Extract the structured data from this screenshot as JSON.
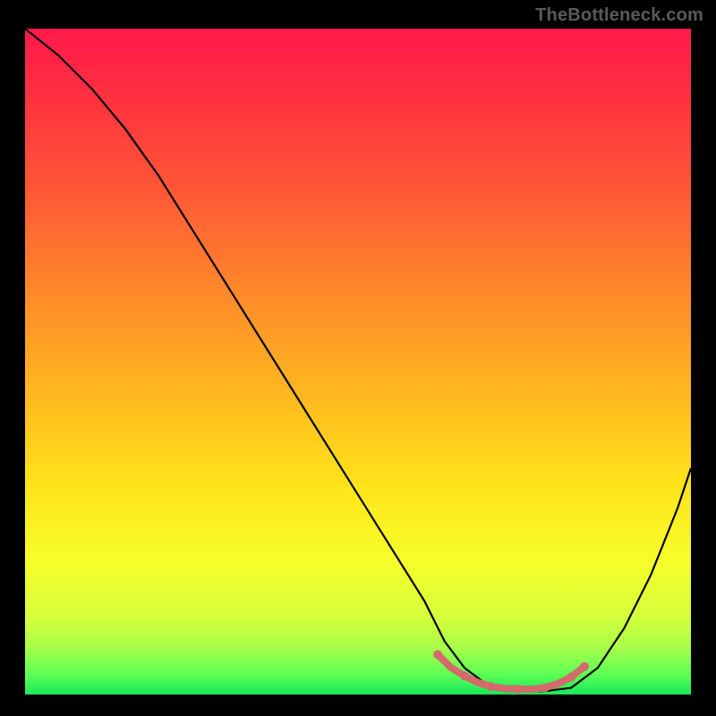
{
  "watermark": "TheBottleneck.com",
  "chart_data": {
    "type": "line",
    "title": "",
    "xlabel": "",
    "ylabel": "",
    "xlim": [
      0,
      100
    ],
    "ylim": [
      0,
      100
    ],
    "curve": {
      "name": "bottleneck-curve",
      "x": [
        0,
        5,
        10,
        15,
        20,
        25,
        30,
        35,
        40,
        45,
        50,
        55,
        60,
        63,
        66,
        70,
        74,
        78,
        82,
        86,
        90,
        94,
        98,
        100
      ],
      "y": [
        100,
        96,
        91,
        85,
        78,
        70,
        62,
        54,
        46,
        38,
        30,
        22,
        14,
        8,
        4,
        1,
        0.5,
        0.5,
        1,
        4,
        10,
        18,
        28,
        34
      ]
    },
    "highlight": {
      "name": "optimal-range",
      "x": [
        62,
        64,
        66,
        68,
        70,
        72,
        74,
        76,
        78,
        80,
        82,
        84
      ],
      "y": [
        6.0,
        4.0,
        2.8,
        1.8,
        1.2,
        0.9,
        0.8,
        0.8,
        1.0,
        1.6,
        2.6,
        4.2
      ]
    },
    "gradient_stops": [
      {
        "offset": 0.0,
        "color": "#ff1a4b"
      },
      {
        "offset": 0.1,
        "color": "#ff3040"
      },
      {
        "offset": 0.25,
        "color": "#ff5a36"
      },
      {
        "offset": 0.4,
        "color": "#ff8a2a"
      },
      {
        "offset": 0.55,
        "color": "#ffb81f"
      },
      {
        "offset": 0.68,
        "color": "#ffe21a"
      },
      {
        "offset": 0.8,
        "color": "#f6ff2a"
      },
      {
        "offset": 0.88,
        "color": "#d8ff3a"
      },
      {
        "offset": 0.93,
        "color": "#a8ff4a"
      },
      {
        "offset": 0.97,
        "color": "#5cff55"
      },
      {
        "offset": 1.0,
        "color": "#18e85a"
      }
    ],
    "highlight_color": "#d46a6a",
    "curve_color": "#000000"
  }
}
